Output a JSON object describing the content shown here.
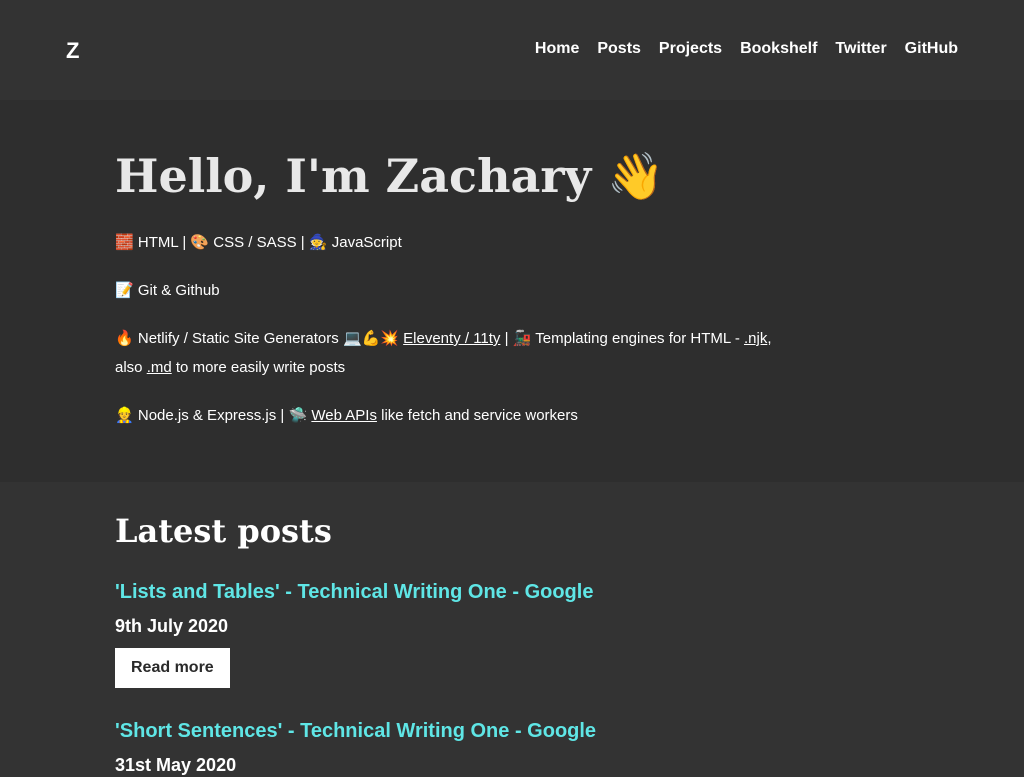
{
  "header": {
    "brand": "Z",
    "nav": [
      "Home",
      "Posts",
      "Projects",
      "Bookshelf",
      "Twitter",
      "GitHub"
    ]
  },
  "intro": {
    "greeting": "Hello, I'm Zachary",
    "greeting_emoji": "👋",
    "line1": {
      "html_icon": "🧱",
      "html": "HTML",
      "sep1": "|",
      "css_icon": "🎨",
      "css": "CSS / SASS",
      "sep2": "|",
      "js_icon": "🧙",
      "js": "JavaScript"
    },
    "line2": {
      "icon": "📝",
      "text": "Git & Github"
    },
    "line3": {
      "icon": "🔥",
      "text1": "Netlify / Static Site Generators",
      "icons": "💻💪💥",
      "link1": "Eleventy / 11ty",
      "sep": "|",
      "icon2": "🚂",
      "text2": "Templating engines for HTML -",
      "link2": ".njk",
      "text3": ",",
      "text4": "also",
      "link3": ".md",
      "text5": "to more easily write posts"
    },
    "line4": {
      "icon": "👷",
      "text1": "Node.js & Express.js",
      "sep": "|",
      "icon2": "🛸",
      "link": "Web APIs",
      "text2": "like fetch and service workers"
    }
  },
  "latest": {
    "title": "Latest posts",
    "posts": [
      {
        "title": "'Lists and Tables' - Technical Writing One - Google",
        "date": "9th July 2020",
        "button": "Read more"
      },
      {
        "title": "'Short Sentences' - Technical Writing One - Google",
        "date": "31st May 2020"
      }
    ]
  },
  "colors": {
    "background": "#333333",
    "intro_background": "#2e2e2e",
    "link_accent": "#5fe6e6",
    "button_bg": "#ffffff"
  }
}
